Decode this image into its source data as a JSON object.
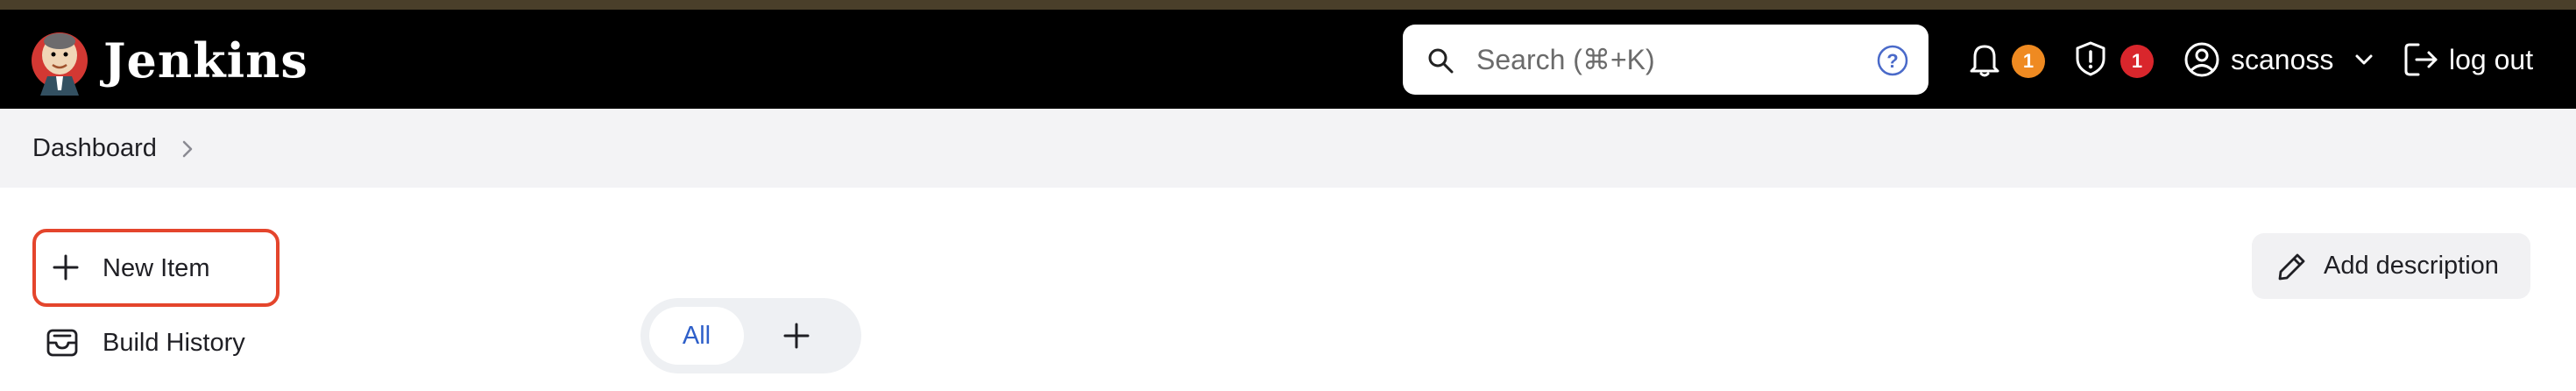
{
  "header": {
    "brand": "Jenkins",
    "logo_icon": "jenkins-butler-logo",
    "search": {
      "placeholder": "Search (⌘+K)",
      "icon": "search-icon",
      "help_icon": "help-circle-icon"
    },
    "notifications": {
      "icon": "bell-icon",
      "count": "1",
      "badge_color": "#ef8a21"
    },
    "security": {
      "icon": "shield-alert-icon",
      "count": "1",
      "badge_color": "#d9262c"
    },
    "user": {
      "name": "scanoss",
      "icon": "user-circle-icon",
      "dropdown_icon": "chevron-down-icon"
    },
    "logout": {
      "label": "log out",
      "icon": "logout-icon"
    }
  },
  "breadcrumb": {
    "items": [
      {
        "label": "Dashboard"
      }
    ]
  },
  "sidebar": {
    "items": [
      {
        "label": "New Item",
        "icon": "plus-icon"
      },
      {
        "label": "Build History",
        "icon": "inbox-icon"
      }
    ]
  },
  "main": {
    "add_description": {
      "label": "Add description",
      "icon": "pencil-icon"
    },
    "view_tabs": {
      "active": "All",
      "add_icon": "plus-icon"
    }
  },
  "colors": {
    "highlight_border": "#e4452c",
    "active_tab_text": "#2e5fc9",
    "header_bg": "#000000"
  }
}
